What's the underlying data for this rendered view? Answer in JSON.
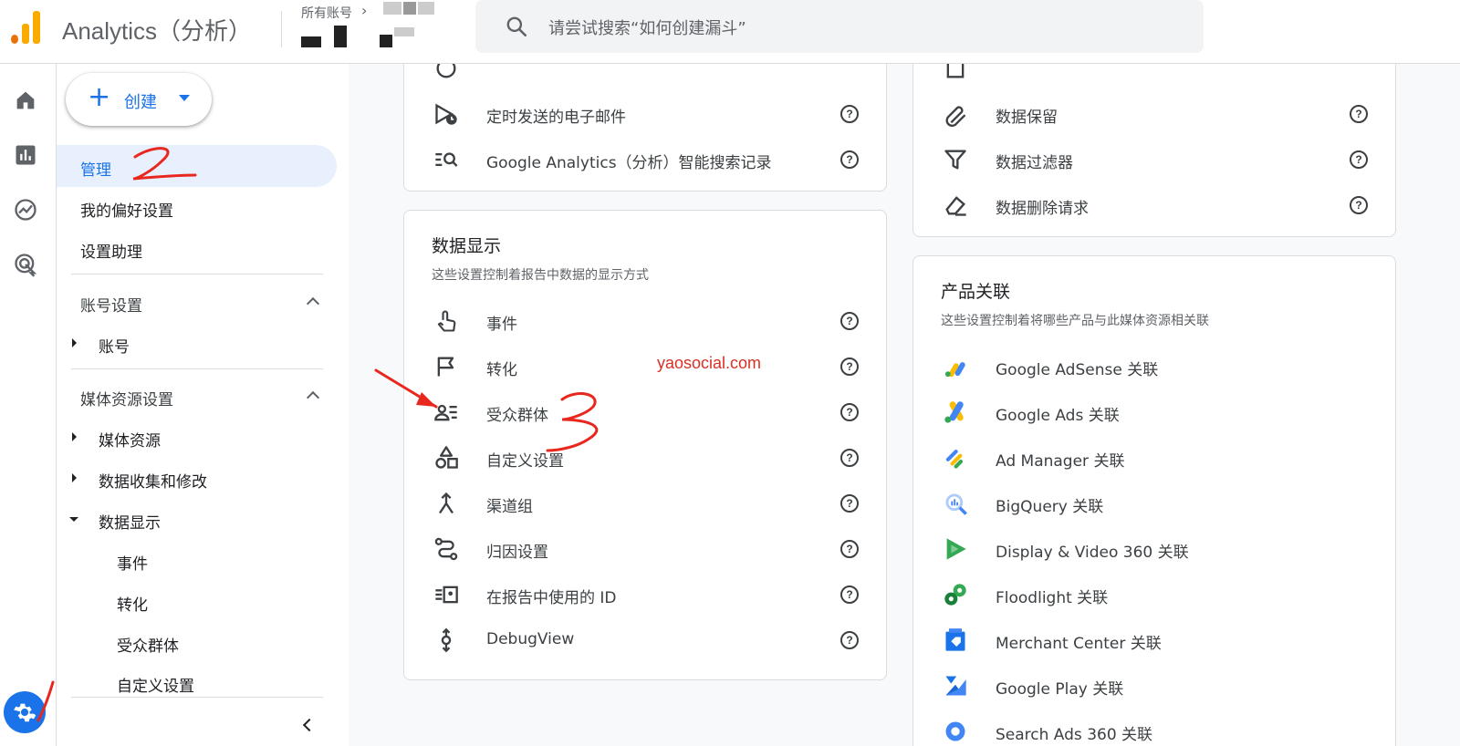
{
  "app": {
    "title": "Analytics（分析）",
    "account_label": "所有账号",
    "account_chevron": "›"
  },
  "search": {
    "placeholder": "请尝试搜索“如何创建漏斗”"
  },
  "rail": {
    "icons": [
      "home-icon",
      "reports-icon",
      "explore-icon",
      "advertising-icon",
      "admin-gear-icon"
    ]
  },
  "nav": {
    "create_label": "创建",
    "items": [
      {
        "label": "管理",
        "active": true
      },
      {
        "label": "我的偏好设置"
      },
      {
        "label": "设置助理"
      }
    ],
    "account_section": "账号设置",
    "account_children": [
      "账号"
    ],
    "property_section": "媒体资源设置",
    "property_children": [
      "媒体资源",
      "数据收集和修改",
      "数据显示"
    ],
    "data_display_children": [
      "事件",
      "转化",
      "受众群体",
      "自定义设置"
    ]
  },
  "cards": {
    "top_left": {
      "items": [
        "定时发送的电子邮件",
        "Google Analytics（分析）智能搜索记录"
      ]
    },
    "top_right": {
      "items": [
        "数据保留",
        "数据过滤器",
        "数据删除请求"
      ]
    },
    "data_display": {
      "title": "数据显示",
      "subtitle": "这些设置控制着报告中数据的显示方式",
      "items": [
        "事件",
        "转化",
        "受众群体",
        "自定义设置",
        "渠道组",
        "归因设置",
        "在报告中使用的 ID",
        "DebugView"
      ]
    },
    "product_links": {
      "title": "产品关联",
      "subtitle": "这些设置控制着将哪些产品与此媒体资源相关联",
      "items": [
        "Google AdSense 关联",
        "Google Ads 关联",
        "Ad Manager 关联",
        "BigQuery 关联",
        "Display & Video 360 关联",
        "Floodlight 关联",
        "Merchant Center 关联",
        "Google Play 关联",
        "Search Ads 360 关联"
      ]
    }
  },
  "help_glyph": "?",
  "watermark": "yaosocial.com",
  "colors": {
    "accent": "#1a73e8",
    "annotation": "#e8271e",
    "active_bg": "#e8f0fe"
  }
}
